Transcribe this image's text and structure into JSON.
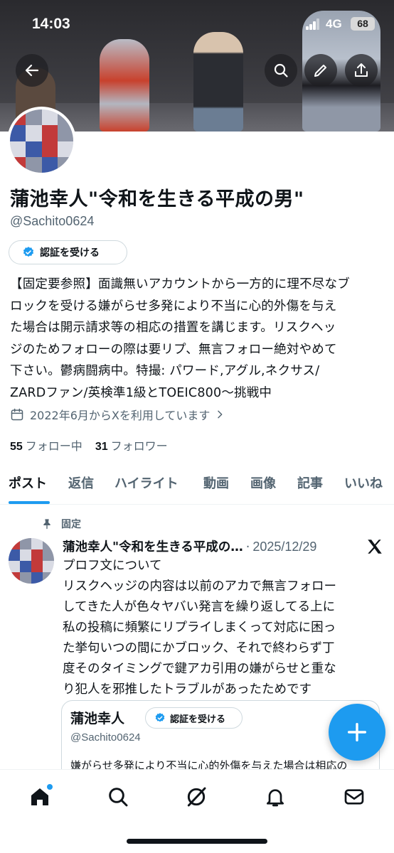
{
  "status_bar": {
    "time": "14:03",
    "network": "4G",
    "battery": "68"
  },
  "profile": {
    "display_name": "蒲池幸人\"令和を生きる平成の男\"",
    "handle": "@Sachito0624",
    "verify_button": "認証を受ける",
    "bio_lines": [
      "【固定要参照】面識無いアカウントから一方的に理不尽なブ",
      "ロックを受ける嫌がらせ多発により不当に心的外傷を与え",
      "た場合は開示請求等の相応の措置を講じます。リスクヘッ",
      "ジのためフォローの際は要リプ、無言フォロー絶対やめて",
      "下さい。鬱病闘病中。特撮: パワード,アグル,ネクサス/",
      "ZARDファン/英検準1級とTOEIC800〜挑戦中"
    ],
    "joined": "2022年6月からXを利用しています",
    "following_count": "55",
    "following_label": "フォロー中",
    "followers_count": "31",
    "followers_label": "フォロワー"
  },
  "tabs": [
    "ポスト",
    "返信",
    "ハイライト",
    "動画",
    "画像",
    "記事",
    "いいね"
  ],
  "pinned_post": {
    "pinned_label": "固定",
    "author": "蒲池幸人\"令和を生きる平成の…",
    "separator": "·",
    "date": "2025/12/29",
    "body": "プロフ文について\nリスクヘッジの内容は以前のアカで無言フォロー\nしてきた人が色々ヤバい発言を繰り返してる上に\n私の投稿に頻繁にリプライしまくって対応に困っ\nた挙句いつの間にかブロック、それで終わらず丁\n度そのタイミングで鍵アカ引用の嫌がらせと重な\nり犯人を邪推したトラブルがあったためです",
    "quote": {
      "name": "蒲池幸人",
      "verify_button": "認証を受ける",
      "handle": "@Sachito0624",
      "text": "嫌がらせ多発により不当に心的外傷を与えた場合は相応の"
    }
  },
  "bottom_nav": [
    "home",
    "search",
    "grok",
    "notifications",
    "messages"
  ],
  "colors": {
    "accent": "#1d9bf0",
    "text": "#0f1419",
    "secondary": "#536471"
  }
}
